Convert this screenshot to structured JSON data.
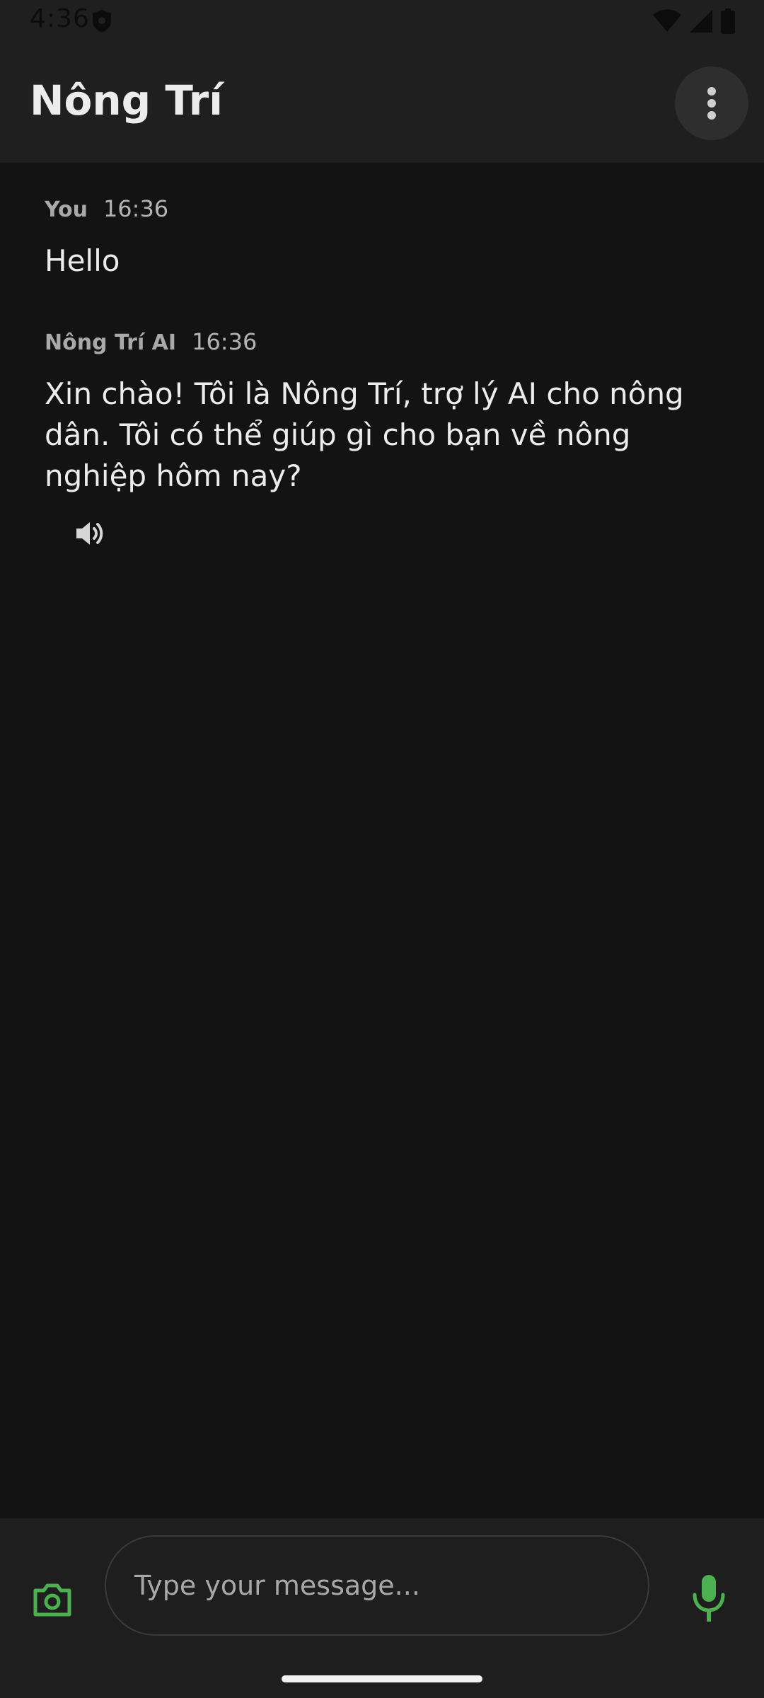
{
  "status_bar": {
    "time": "4:36",
    "icons": [
      "shield-icon",
      "wifi-icon",
      "cellular-signal-icon",
      "battery-icon"
    ]
  },
  "app_bar": {
    "title": "Nông Trí",
    "menu_icon": "more-vertical-icon"
  },
  "messages": [
    {
      "sender": "You",
      "time": "16:36",
      "text": "Hello"
    },
    {
      "sender": "Nông Trí AI",
      "time": "16:36",
      "text": "Xin chào! Tôi là Nông Trí, trợ lý AI cho nông dân. Tôi có thể giúp gì cho bạn về nông nghiệp hôm nay?",
      "action_icon": "speaker-icon"
    }
  ],
  "composer": {
    "placeholder": "Type your message...",
    "value": "",
    "camera_icon": "camera-icon",
    "mic_icon": "microphone-icon",
    "accent_color": "#4caf50"
  }
}
